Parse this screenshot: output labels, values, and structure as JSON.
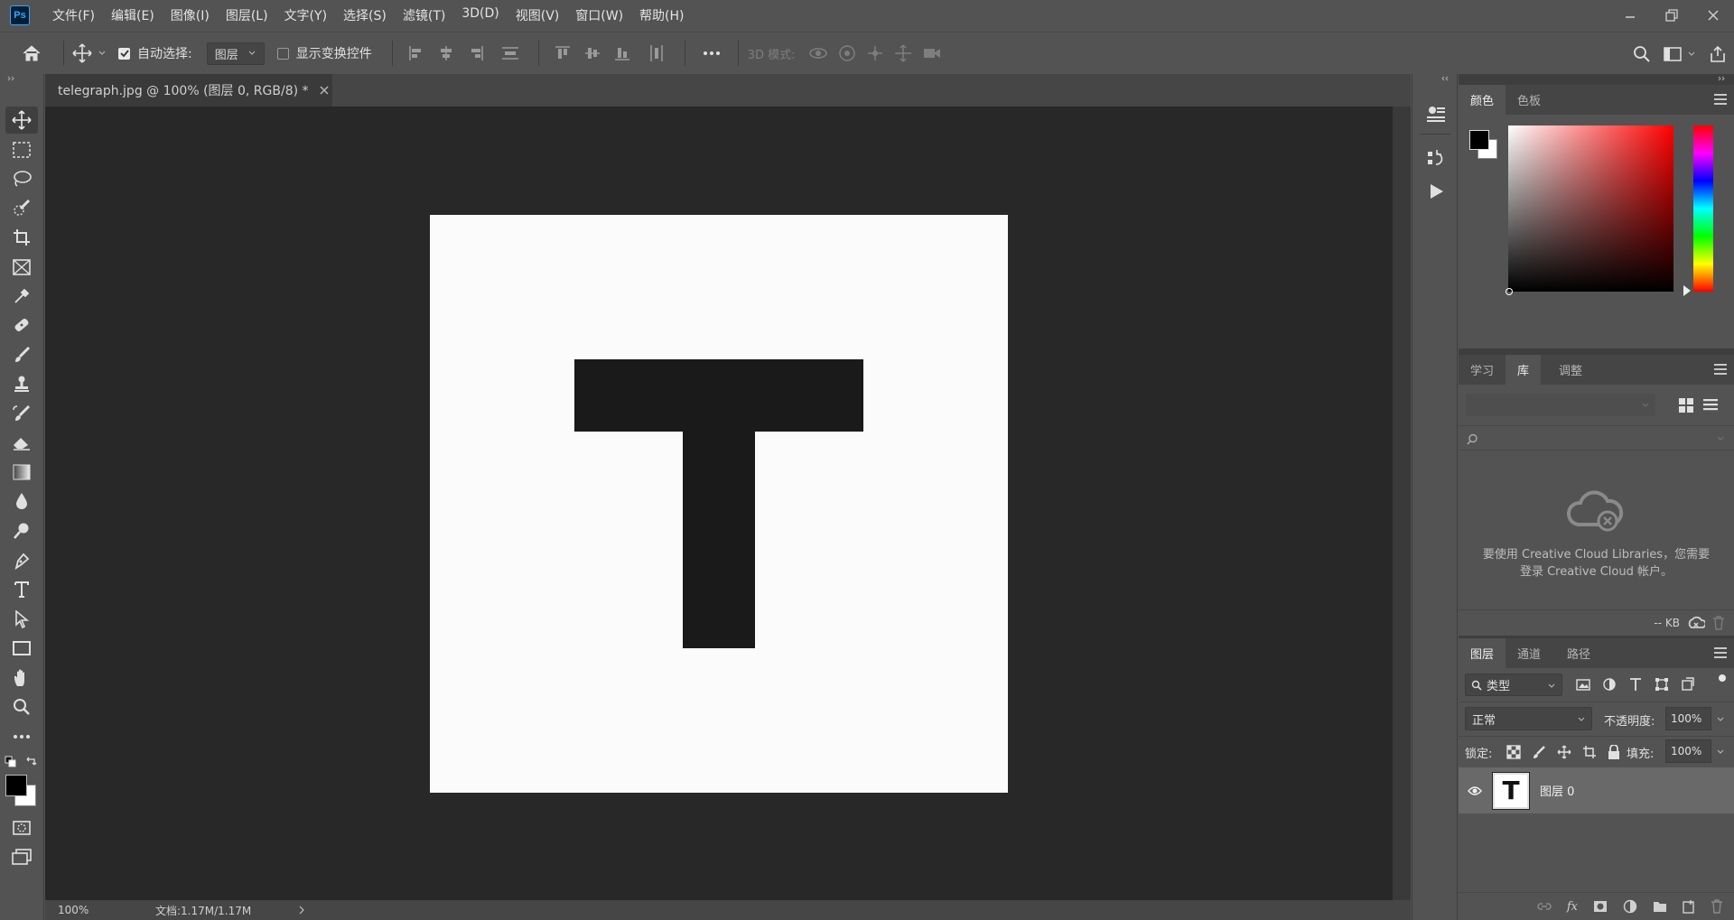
{
  "app": {
    "logo": "Ps"
  },
  "menu": [
    "文件(F)",
    "编辑(E)",
    "图像(I)",
    "图层(L)",
    "文字(Y)",
    "选择(S)",
    "滤镜(T)",
    "3D(D)",
    "视图(V)",
    "窗口(W)",
    "帮助(H)"
  ],
  "options": {
    "auto_select_label": "自动选择:",
    "auto_select_checked": true,
    "target_value": "图层",
    "show_transform_label": "显示变换控件",
    "show_transform_checked": false,
    "mode_3d_label": "3D 模式:"
  },
  "document": {
    "tab_title": "telegraph.jpg @ 100% (图层 0, RGB/8) *",
    "zoom": "100%",
    "doc_info": "文档:1.17M/1.17M",
    "content_letter": "T"
  },
  "color_panel": {
    "tabs": [
      "颜色",
      "色板"
    ],
    "fg": "#000000",
    "bg": "#ffffff"
  },
  "library_panel": {
    "tabs": [
      "学习",
      "库",
      "调整"
    ],
    "message_line1": "要使用 Creative Cloud Libraries，您需要",
    "message_line2": "登录 Creative Cloud 帐户。",
    "size": "-- KB"
  },
  "layers_panel": {
    "tabs": [
      "图层",
      "通道",
      "路径"
    ],
    "filter_kind": "类型",
    "blend_mode": "正常",
    "opacity_label": "不透明度:",
    "opacity_value": "100%",
    "lock_label": "锁定:",
    "fill_label": "填充:",
    "fill_value": "100%",
    "layers": [
      {
        "name": "图层 0",
        "thumb": "T",
        "visible": true
      }
    ]
  },
  "colors": {
    "accent": "#31a8ff",
    "ui": "#535353",
    "canvas_bg": "#282828",
    "glyph": "#1a1a1a"
  }
}
